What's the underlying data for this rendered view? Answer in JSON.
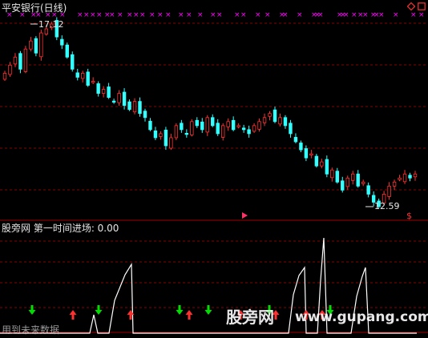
{
  "window": {
    "title": "平安银行(日线)",
    "icons": [
      "diamond-icon",
      "window-square-icon"
    ]
  },
  "main_chart": {
    "price_high_label": "17.12",
    "price_low_label": "12.59",
    "up_color": "#ff3333",
    "down_color": "#33ffff",
    "marker_color": "#ff00ff",
    "grid_color": "#8a0000"
  },
  "indicator": {
    "name": "股旁网 第一时间进场: 0.00",
    "line_color": "#ffffff",
    "up_arrow_color": "#ff3030",
    "down_arrow_color": "#00dd00"
  },
  "watermark": {
    "brand": "股旁网",
    "url": "www.gupang.com"
  },
  "footer": {
    "note": "用到未来数据"
  },
  "chart_data": {
    "type": "candlestick",
    "title": "平安银行(日线)",
    "annotations": [
      "17.12",
      "12.59"
    ],
    "close_series": [
      15.9,
      16.1,
      16.3,
      16.0,
      16.5,
      16.7,
      16.4,
      16.9,
      17.0,
      17.12,
      16.8,
      16.6,
      16.3,
      16.0,
      15.8,
      15.9,
      15.6,
      15.7,
      15.4,
      15.5,
      15.3,
      15.2,
      15.4,
      15.1,
      15.0,
      15.2,
      14.9,
      14.8,
      14.5,
      14.3,
      14.4,
      14.1,
      14.3,
      14.6,
      14.5,
      14.4,
      14.7,
      14.6,
      14.5,
      14.8,
      14.6,
      14.4,
      14.6,
      14.7,
      14.5,
      14.6,
      14.5,
      14.4,
      14.6,
      14.7,
      14.8,
      14.9,
      14.7,
      14.8,
      14.6,
      14.4,
      14.2,
      14.0,
      13.8,
      13.9,
      13.6,
      13.7,
      13.4,
      13.5,
      13.2,
      13.0,
      13.3,
      13.4,
      13.1,
      13.2,
      12.9,
      12.7,
      12.59,
      12.9,
      13.1,
      13.2,
      13.3,
      13.4,
      13.3,
      13.4
    ]
  }
}
